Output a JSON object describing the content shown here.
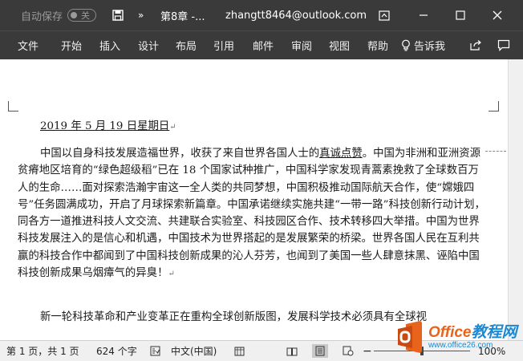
{
  "titlebar": {
    "autosave_label": "自动保存",
    "autosave_state": "关",
    "overflow_glyph": "»",
    "doc_title": "第8章 -...",
    "account": "zhangtt8464@outlook.com"
  },
  "ribbon": {
    "tabs": [
      "文件",
      "开始",
      "插入",
      "设计",
      "布局",
      "引用",
      "邮件",
      "审阅",
      "视图",
      "帮助"
    ],
    "tell_me": "告诉我"
  },
  "document": {
    "date_line": "2019 年 5 月 19 日星期日",
    "para1_a": "中国以自身科技发展造福世界，收获了来自世界各国人士的",
    "para1_u": "真诚点赞",
    "para1_b": "。中国为非洲和亚洲资源贫瘠地区培育的“绿色超级稻”已在 18 个国家试种推广，中国科学家发现青蒿素挽救了全球数百万人的生命……面对探索浩瀚宇宙这一全人类的共同梦想，中国积极推动国际航天合作，使“嫦娥四号”任务圆满成功，开启了月球探索新篇章。中国承诺继续实施共建“一带一路”科技创新行动计划，同各方一道推进科技人文交流、共建联合实验室、科技园区合作、技术转移四大举措。中国为世界科技发展注入的是信心和机遇，中国技术为世界搭起的是发展繁荣的桥梁。世界各国人民在互利共赢的科技合作中都闻到了中国科技创新成果的沁人芬芳，也闻到了美国一些人肆意抹黑、诬陷中国科技创新成果乌烟瘴气的异臭！",
    "para2": "新一轮科技革命和产业变革正在重构全球创新版图，发展科学技术必须具有全球视"
  },
  "statusbar": {
    "page": "第 1 页，共 1 页",
    "words": "624 个字",
    "language": "中文(中国)",
    "zoom_pct": 100,
    "zoom_text": "100%"
  },
  "watermark": {
    "brand_latin": "Office",
    "brand_cn": "教程网",
    "url": "www.office26.com"
  },
  "colors": {
    "titlebar_bg": "#3a3a3a",
    "statusbar_bg": "#f0f0f0",
    "logo_orange": "#e8631c",
    "logo_blue": "#1e88d0"
  }
}
